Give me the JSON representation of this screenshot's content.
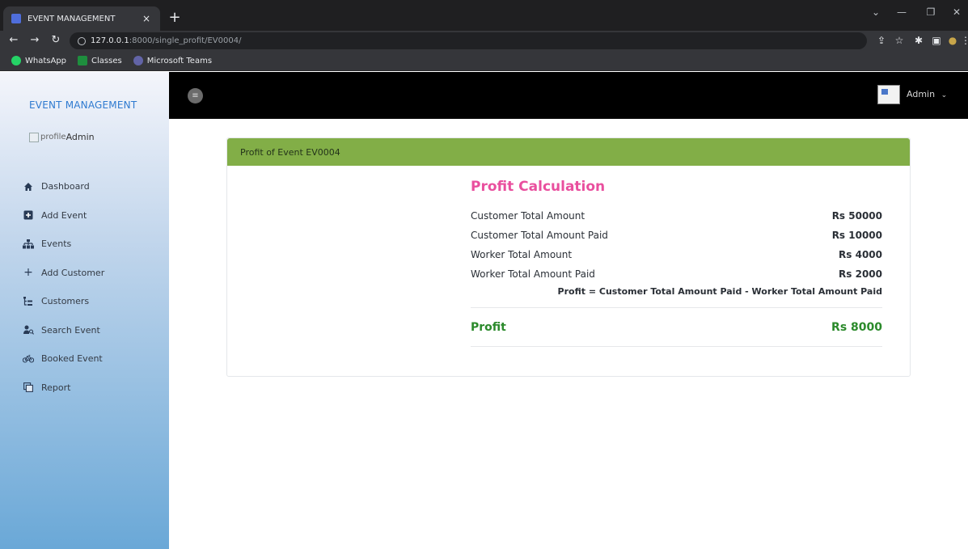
{
  "browser": {
    "tab_title": "EVENT MANAGEMENT",
    "tab_close": "×",
    "new_tab": "+",
    "url_host": "127.0.0.1",
    "url_path": ":8000/single_profit/EV0004/",
    "bookmarks": [
      "WhatsApp",
      "Classes",
      "Microsoft Teams"
    ]
  },
  "sidebar": {
    "brand": "EVENT MANAGEMENT",
    "profile_alt": "profile",
    "profile_name": "Admin",
    "items": [
      {
        "label": "Dashboard",
        "icon": "home-icon"
      },
      {
        "label": "Add Event",
        "icon": "plus-square-icon"
      },
      {
        "label": "Events",
        "icon": "sitemap-icon"
      },
      {
        "label": "Add Customer",
        "icon": "plus-icon"
      },
      {
        "label": "Customers",
        "icon": "list-tree-icon"
      },
      {
        "label": "Search Event",
        "icon": "user-search-icon"
      },
      {
        "label": "Booked Event",
        "icon": "bicycle-icon"
      },
      {
        "label": "Report",
        "icon": "copy-icon"
      }
    ]
  },
  "topbar": {
    "admin_label": "Admin"
  },
  "card": {
    "header": "Profit of Event EV0004",
    "title": "Profit Calculation",
    "rows": [
      {
        "label": "Customer Total Amount",
        "value": "Rs 50000"
      },
      {
        "label": "Customer Total Amount Paid",
        "value": "Rs 10000"
      },
      {
        "label": "Worker Total Amount",
        "value": "Rs 4000"
      },
      {
        "label": "Worker Total Amount Paid",
        "value": "Rs 2000"
      }
    ],
    "formula": "Profit = Customer Total Amount Paid - Worker Total Amount Paid",
    "profit_label": "Profit",
    "profit_value": "Rs 8000"
  },
  "colors": {
    "card_header": "#82ae47",
    "title_pink": "#e94f9e",
    "profit_green": "#2b8a2b",
    "brand_blue": "#2e7ad0"
  }
}
